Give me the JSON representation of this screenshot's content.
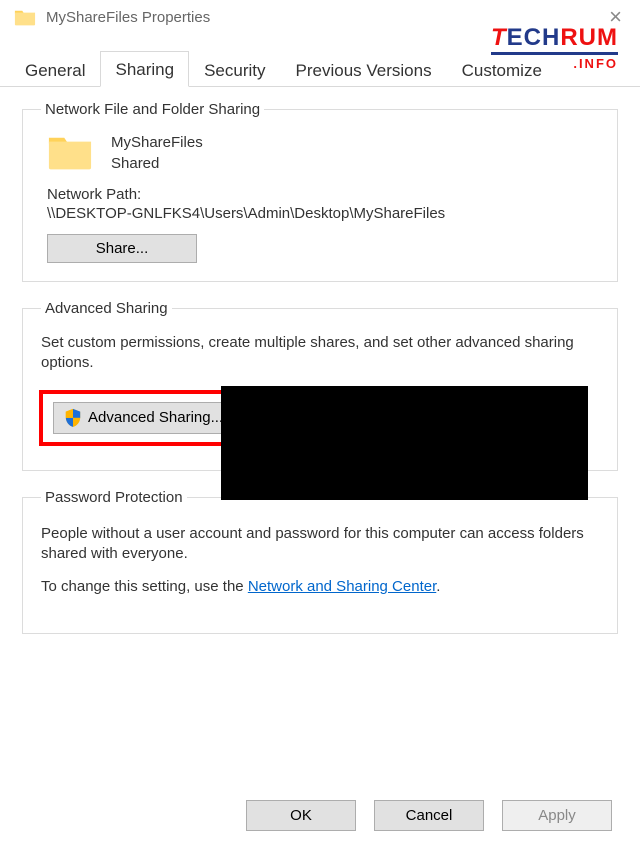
{
  "title": "MyShareFiles Properties",
  "watermark": {
    "t": "T",
    "ech": "ECH",
    "rum": "RUM",
    "info": ".INFO"
  },
  "tabs": {
    "general": "General",
    "sharing": "Sharing",
    "security": "Security",
    "previous": "Previous Versions",
    "customize": "Customize"
  },
  "group_network": {
    "legend": "Network File and Folder Sharing",
    "folder_name": "MyShareFiles",
    "status": "Shared",
    "path_label": "Network Path:",
    "path_value": "\\\\DESKTOP-GNLFKS4\\Users\\Admin\\Desktop\\MyShareFiles",
    "share_btn": "Share..."
  },
  "group_advanced": {
    "legend": "Advanced Sharing",
    "desc": "Set custom permissions, create multiple shares, and set other advanced sharing options.",
    "button": "Advanced Sharing..."
  },
  "group_password": {
    "legend": "Password Protection",
    "line1": "People without a user account and password for this computer can access folders shared with everyone.",
    "line2_pre": "To change this setting, use the ",
    "link": "Network and Sharing Center",
    "line2_post": "."
  },
  "buttons": {
    "ok": "OK",
    "cancel": "Cancel",
    "apply": "Apply"
  }
}
